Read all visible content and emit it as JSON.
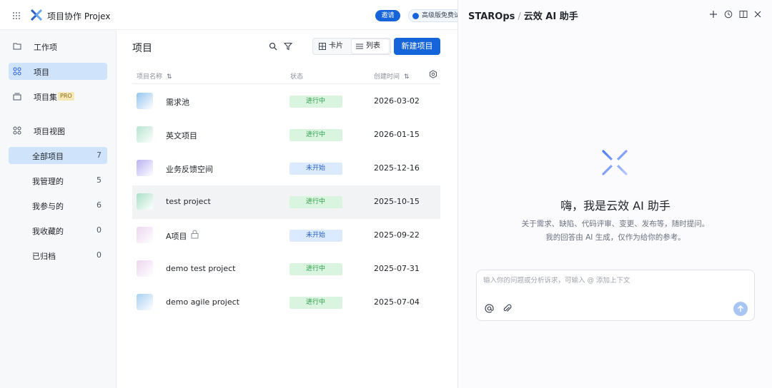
{
  "topbar": {
    "app_title": "项目协作 Projex",
    "invite_label": "邀请",
    "trial_label": "高级版免费试用"
  },
  "sidebar": {
    "nav": [
      {
        "label": "工作项",
        "icon": "folder-icon"
      },
      {
        "label": "项目",
        "icon": "grid-apps-icon",
        "active": true
      },
      {
        "label": "项目集",
        "icon": "stack-icon",
        "badge": "PRO"
      },
      {
        "label": "项目视图",
        "icon": "grid-apps-icon"
      }
    ],
    "views": [
      {
        "label": "全部项目",
        "count": "7",
        "active": true
      },
      {
        "label": "我管理的",
        "count": "5"
      },
      {
        "label": "我参与的",
        "count": "6"
      },
      {
        "label": "我收藏的",
        "count": "0"
      },
      {
        "label": "已归档",
        "count": "0"
      }
    ]
  },
  "main": {
    "title": "项目",
    "view_toggle": {
      "card": "卡片",
      "list": "列表",
      "selected": "list"
    },
    "new_button": "新建项目",
    "columns": {
      "name": "项目名称",
      "status": "状态",
      "created": "创建时间"
    },
    "rows": [
      {
        "name": "需求池",
        "status": "进行中",
        "status_color": "green",
        "date": "2026-03-02",
        "thumb": "#93c5f0"
      },
      {
        "name": "英文项目",
        "status": "进行中",
        "status_color": "green",
        "date": "2026-01-15",
        "thumb": "#b7e4d0"
      },
      {
        "name": "业务反馈空间",
        "status": "未开始",
        "status_color": "blue",
        "date": "2025-12-16",
        "thumb": "#b9b2f2"
      },
      {
        "name": "test project",
        "status": "进行中",
        "status_color": "green",
        "date": "2025-10-15",
        "thumb": "#a8e0c8",
        "highlighted": true
      },
      {
        "name": "A项目",
        "status": "未开始",
        "status_color": "blue",
        "date": "2025-09-22",
        "thumb": "#ecd6ef",
        "locked": true
      },
      {
        "name": "demo test project",
        "status": "进行中",
        "status_color": "green",
        "date": "2025-07-31",
        "thumb": "#ecd6ef"
      },
      {
        "name": "demo agile project",
        "status": "进行中",
        "status_color": "green",
        "date": "2025-07-04",
        "thumb": "#a9d1f2"
      }
    ]
  },
  "ai_panel": {
    "brand": "STAROps",
    "title": "云效 AI 助手",
    "greeting": "嗨，我是云效 AI 助手",
    "subtitle_1": "关于需求、缺陷、代码评审、变更、发布等，随时提问。",
    "subtitle_2": "我的回答由 AI 生成，仅作为给你的参考。",
    "input_placeholder": "输入你的问题或分析诉求，可输入 @ 添加上下文"
  },
  "colors": {
    "accent": "#1664d9",
    "active_bg": "#cfe3fb",
    "green_tag": "#daf5df",
    "blue_tag": "#dbeafe"
  }
}
